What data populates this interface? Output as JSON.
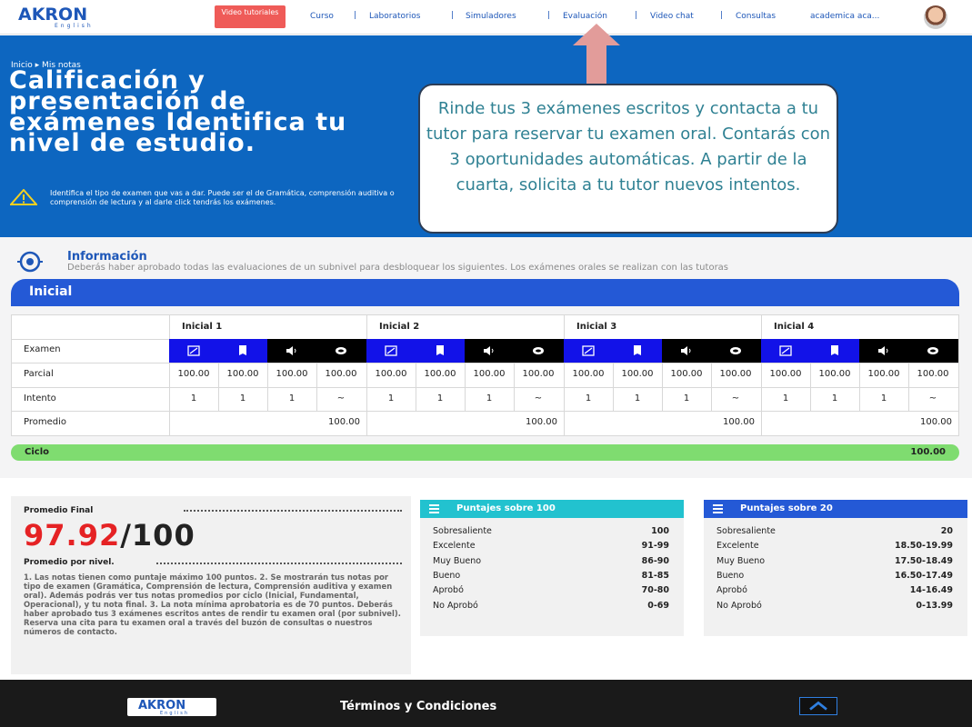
{
  "header": {
    "logo_text": "AKRON",
    "logo_sub": "English",
    "video_button": "Video tutoriales",
    "nav": [
      "Curso",
      "Laboratorios",
      "Simuladores",
      "Evaluación",
      "Video chat",
      "Consultas"
    ],
    "user_name": "academica aca..."
  },
  "hero": {
    "breadcrumb": "Inicio ▸ Mis notas",
    "title": "Calificación y presentación de exámenes Identifica tu nivel de estudio.",
    "description": "Identifica el tipo de examen que vas a dar. Puede ser el de Gramática, comprensión auditiva o comprensión de lectura y al darle click tendrás los exámenes."
  },
  "callout": {
    "text": "Rinde tus 3 exámenes escritos y contacta a tu tutor para reservar tu examen oral. Contarás con 3 oportunidades automáticas. A partir de la cuarta, solicita a tu tutor nuevos intentos.",
    "arrow_color": "#e29c9a"
  },
  "info": {
    "title": "Información",
    "description": "Deberás haber aprobado todas las evaluaciones de un subnivel para desbloquear los siguientes. Los exámenes orales se realizan con las tutoras"
  },
  "grades": {
    "level": "Inicial",
    "row_labels": [
      "Examen",
      "Parcial",
      "Intento",
      "Promedio"
    ],
    "groups": [
      {
        "name": "Inicial 1",
        "parcial": [
          "100.00",
          "100.00",
          "100.00",
          "100.00"
        ],
        "intento": [
          "1",
          "1",
          "1",
          "~"
        ],
        "promedio": "100.00"
      },
      {
        "name": "Inicial 2",
        "parcial": [
          "100.00",
          "100.00",
          "100.00",
          "100.00"
        ],
        "intento": [
          "1",
          "1",
          "1",
          "~"
        ],
        "promedio": "100.00"
      },
      {
        "name": "Inicial 3",
        "parcial": [
          "100.00",
          "100.00",
          "100.00",
          "100.00"
        ],
        "intento": [
          "1",
          "1",
          "1",
          "~"
        ],
        "promedio": "100.00"
      },
      {
        "name": "Inicial 4",
        "parcial": [
          "100.00",
          "100.00",
          "100.00",
          "100.00"
        ],
        "intento": [
          "1",
          "1",
          "1",
          "~"
        ],
        "promedio": "100.00"
      }
    ],
    "exam_icons": [
      "grammar-icon",
      "reading-icon",
      "listening-icon",
      "oral-icon"
    ],
    "ciclo_label": "Ciclo",
    "ciclo_value": "100.00"
  },
  "final": {
    "label": "Promedio Final",
    "score": "97.92",
    "out_of": "/100",
    "per_level_label": "Promedio por nivel.",
    "notes": "1. Las notas tienen como puntaje máximo 100 puntos. 2. Se mostrarán tus notas por tipo de examen (Gramática, Comprensión de lectura, Comprensión auditiva y examen oral). Además podrás ver tus notas promedios por ciclo (Inicial, Fundamental, Operacional), y tu nota final. 3. La nota mínima aprobatoria es de 70 puntos. Deberás haber aprobado tus 3 exámenes escritos antes de rendir tu examen oral (por subnivel). Reserva una cita para tu examen oral a través del buzón de consultas o nuestros números de contacto."
  },
  "scale100": {
    "title": "Puntajes sobre 100",
    "color": "#22c2cf",
    "rows": [
      {
        "k": "Sobresaliente",
        "v": "100"
      },
      {
        "k": "Excelente",
        "v": "91-99"
      },
      {
        "k": "Muy Bueno",
        "v": "86-90"
      },
      {
        "k": "Bueno",
        "v": "81-85"
      },
      {
        "k": "Aprobó",
        "v": "70-80"
      },
      {
        "k": "No Aprobó",
        "v": "0-69"
      }
    ]
  },
  "scale20": {
    "title": "Puntajes sobre 20",
    "color": "#2459d6",
    "rows": [
      {
        "k": "Sobresaliente",
        "v": "20"
      },
      {
        "k": "Excelente",
        "v": "18.50-19.99"
      },
      {
        "k": "Muy Bueno",
        "v": "17.50-18.49"
      },
      {
        "k": "Bueno",
        "v": "16.50-17.49"
      },
      {
        "k": "Aprobó",
        "v": "14-16.49"
      },
      {
        "k": "No Aprobó",
        "v": "0-13.99"
      }
    ]
  },
  "footer": {
    "logo_text": "AKRON",
    "logo_sub": "English",
    "terms": "Términos y Condiciones"
  }
}
